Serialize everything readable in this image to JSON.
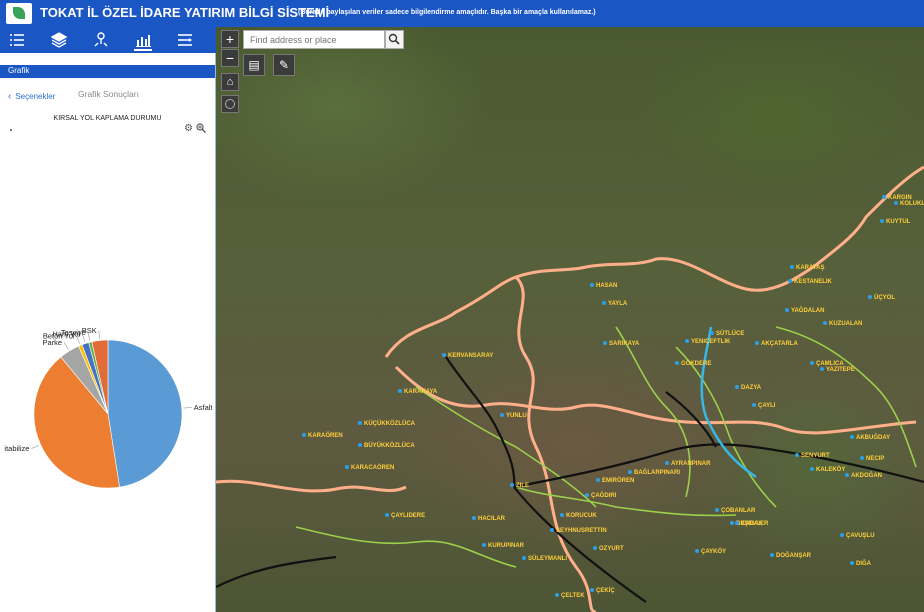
{
  "header": {
    "title": "TOKAT İL ÖZEL İDARE YATIRIM BİLGİ SİSTEMİ",
    "notice": "(Burada paylaşılan veriler sadece bilgilendirme amaçlıdır. Başka bir amaçla kullanılamaz.)"
  },
  "toolbar": {
    "icons": [
      "list-icon",
      "layers-icon",
      "measure-icon",
      "chart-icon",
      "menu-icon"
    ],
    "active_index": 3
  },
  "panel": {
    "tab_label": "Grafik",
    "back_label": "Seçenekler",
    "results_title": "Grafik Sonuçları",
    "chart_title": "KIRSAL YOL KAPLAMA DURUMU"
  },
  "chart_data": {
    "type": "pie",
    "title": "KIRSAL YOL KAPLAMA DURUMU",
    "categories": [
      "Asfalt",
      "Stabilize",
      "Parke",
      "Beton Yol",
      "Ham Yol",
      "Tesviye",
      "BSK"
    ],
    "values": [
      47.5,
      41.5,
      4.5,
      0.8,
      1.5,
      0.7,
      3.5
    ],
    "colors": [
      "#5b9bd5",
      "#ed7d31",
      "#a5a5a5",
      "#ffc000",
      "#4472c4",
      "#70ad47",
      "#e06c3a"
    ],
    "labels_shown": [
      "Asfalt",
      "itabilize",
      "Parke",
      "Beton Yol",
      "Ham Yol",
      "Tesviye",
      "BSK"
    ]
  },
  "map": {
    "search_placeholder": "Find address or place",
    "zoom_in": "+",
    "zoom_out": "−",
    "places": [
      "SÜTLÜCE",
      "AKÇATARLA",
      "KUZUALAN",
      "ÇAMLICA",
      "YAZITEPE",
      "ÜÇYOL",
      "KOLUKLU",
      "ÇAYLI",
      "DAZYA",
      "KERVANSARAY",
      "KARAKAYA",
      "YUNLU",
      "KÜÇÜKKÖZLÜCA",
      "BÜYÜKKÖZLÜCA",
      "KARACAÖREN",
      "YAĞDALAN",
      "KARAÖREN",
      "AYRANPINAR",
      "BAĞLARPINARI",
      "ÇAYLIDERE",
      "SENYURT",
      "KALEKÖY",
      "EMIRÖREN",
      "ÇAĞDIRI",
      "ZILE",
      "KORUCUK",
      "ÇOBANLAR",
      "SEYHNUSRETTIN",
      "HACILAR",
      "OZYURT",
      "KURUPINAR",
      "SÜLEYMANLI",
      "ÇEKİÇ",
      "ÇELTEK",
      "BEŞEVLER",
      "ÇAYKÖY",
      "DOĞANŞAR",
      "AKBUĞDAY",
      "KARGIN",
      "KUYTUL",
      "KESTANELIK",
      "KARATAŞ",
      "NECIP",
      "AKDOĞAN",
      "ÇAVUŞLU",
      "DIĞA",
      "KABAK",
      "SARIKAYA",
      "GÖKDERE",
      "YENIÇEFTLIK",
      "HASAN",
      "YAYLA"
    ]
  }
}
